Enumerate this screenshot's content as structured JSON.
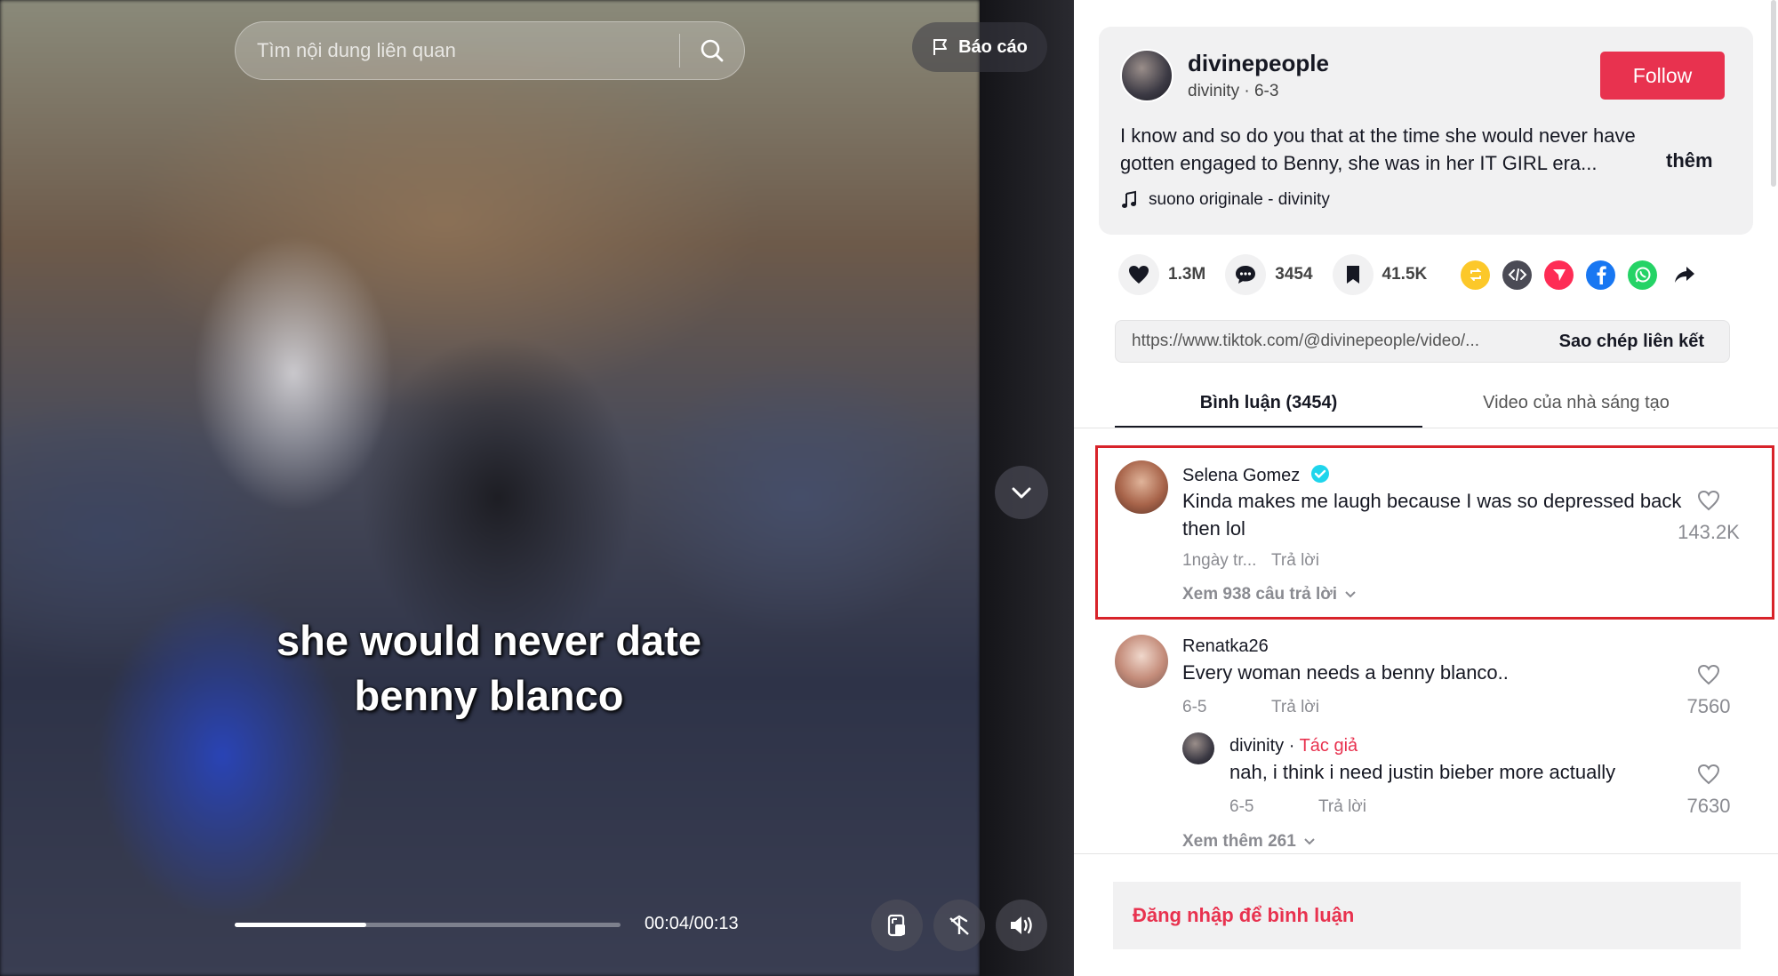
{
  "video": {
    "search_placeholder": "Tìm nội dung liên quan",
    "report_label": "Báo cáo",
    "caption_line1": "she would never date",
    "caption_line2": "benny blanco",
    "time": "00:04/00:13",
    "progress": 0.34
  },
  "author": {
    "username": "divinepeople",
    "meta": "divinity · 6-3",
    "follow_label": "Follow",
    "description": "I know and so do you that at the time she would never have gotten engaged to Benny, she was in her IT GIRL era...",
    "more_label": "thêm",
    "music": "suono originale - divinity"
  },
  "stats": {
    "likes": "1.3M",
    "comments": "3454",
    "saves": "41.5K"
  },
  "share_icons": [
    "repost-icon",
    "embed-icon",
    "send-icon",
    "facebook-icon",
    "whatsapp-icon",
    "share-arrow-icon"
  ],
  "link": {
    "url": "https://www.tiktok.com/@divinepeople/video/...",
    "copy_label": "Sao chép liên kết"
  },
  "tabs": {
    "comments": "Bình luận (3454)",
    "creator_videos": "Video của nhà sáng tạo"
  },
  "comments": [
    {
      "user": "Selena Gomez",
      "verified": true,
      "text": "Kinda makes me laugh because I was so depressed back then lol",
      "time": "1ngày tr...",
      "reply_label": "Trả lời",
      "likes": "143.2K",
      "view_replies": "Xem 938 câu trả lời"
    },
    {
      "user": "Renatka26",
      "text": "Every woman needs a benny blanco..",
      "time": "6-5",
      "reply_label": "Trả lời",
      "likes": "7560",
      "reply": {
        "user": "divinity",
        "separator": " · ",
        "author_tag": "Tác giả",
        "text": "nah, i think i need justin bieber more actually",
        "time": "6-5",
        "reply_label": "Trả lời",
        "likes": "7630"
      },
      "view_more": "Xem thêm 261"
    }
  ],
  "login_prompt": "Đăng nhập để bình luận",
  "colors": {
    "accent": "#e8324f",
    "highlight_border": "#d8232a",
    "verified": "#20d5ec"
  }
}
